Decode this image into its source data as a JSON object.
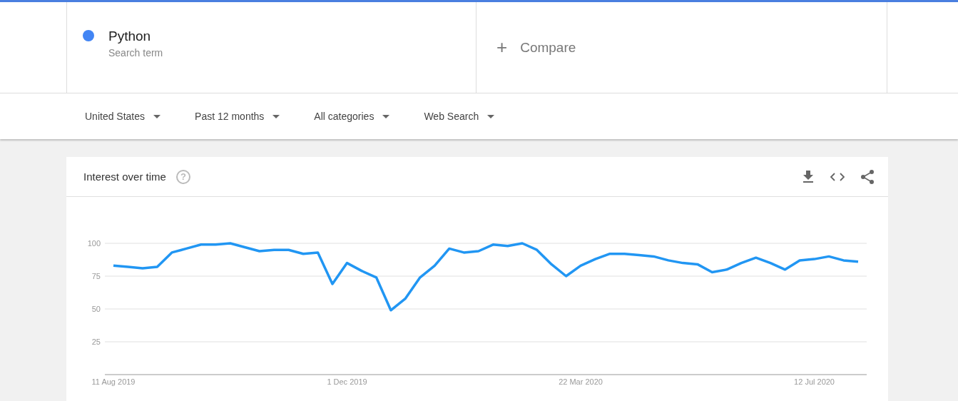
{
  "search_term": {
    "name": "Python",
    "subtitle": "Search term",
    "color": "#4285f4"
  },
  "compare": {
    "icon": "+",
    "label": "Compare"
  },
  "filters": [
    {
      "label": "United States"
    },
    {
      "label": "Past 12 months"
    },
    {
      "label": "All categories"
    },
    {
      "label": "Web Search"
    }
  ],
  "interest_card": {
    "title": "Interest over time",
    "help_icon": "?",
    "chart_data": {
      "type": "line",
      "grid": true,
      "ylim": [
        0,
        100
      ],
      "categories": [
        "11 Aug 2019",
        null,
        null,
        null,
        null,
        null,
        null,
        null,
        null,
        null,
        null,
        null,
        null,
        null,
        null,
        null,
        "1 Dec 2019",
        null,
        null,
        null,
        null,
        null,
        null,
        null,
        null,
        null,
        null,
        null,
        null,
        null,
        null,
        null,
        "22 Mar 2020",
        null,
        null,
        null,
        null,
        null,
        null,
        null,
        null,
        null,
        null,
        null,
        null,
        null,
        null,
        null,
        "12 Jul 2020",
        null,
        null,
        null
      ],
      "yticks": [
        25,
        50,
        75,
        100
      ],
      "series": [
        {
          "color": "#2196f3",
          "values": [
            83,
            82,
            81,
            82,
            93,
            96,
            99,
            99,
            100,
            97,
            94,
            95,
            95,
            92,
            93,
            69,
            85,
            79,
            74,
            49,
            58,
            74,
            83,
            96,
            93,
            94,
            99,
            98,
            100,
            95,
            84,
            75,
            83,
            88,
            92,
            92,
            91,
            90,
            87,
            85,
            84,
            78,
            80,
            85,
            89,
            85,
            80,
            87,
            88,
            90,
            87,
            86
          ]
        }
      ]
    }
  }
}
